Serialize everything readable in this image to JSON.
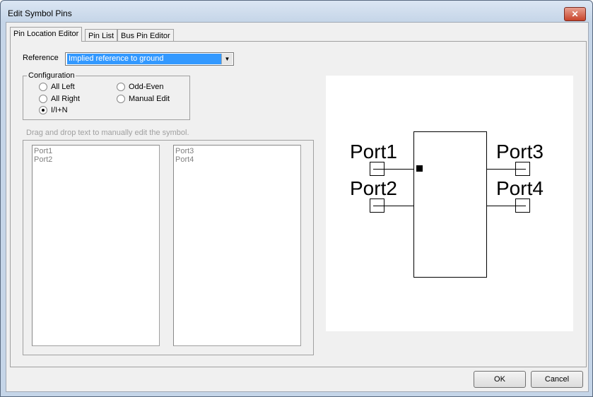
{
  "window": {
    "title": "Edit Symbol Pins",
    "close_label": "✕"
  },
  "tabs": [
    {
      "label": "Pin Location Editor"
    },
    {
      "label": "Pin List"
    },
    {
      "label": "Bus Pin Editor"
    }
  ],
  "reference": {
    "label": "Reference",
    "value": "Implied reference to ground"
  },
  "configuration": {
    "label": "Configuration",
    "options": [
      {
        "label": "All Left",
        "checked": false
      },
      {
        "label": "All Right",
        "checked": false
      },
      {
        "label": "I/I+N",
        "checked": true
      },
      {
        "label": "Odd-Even",
        "checked": false
      },
      {
        "label": "Manual Edit",
        "checked": false
      }
    ]
  },
  "hint": "Drag and drop text to manually edit the symbol.",
  "left_list": [
    "Port1",
    "Port2"
  ],
  "right_list": [
    "Port3",
    "Port4"
  ],
  "preview": {
    "ports": [
      "Port1",
      "Port2",
      "Port3",
      "Port4"
    ]
  },
  "buttons": {
    "ok": "OK",
    "cancel": "Cancel"
  }
}
